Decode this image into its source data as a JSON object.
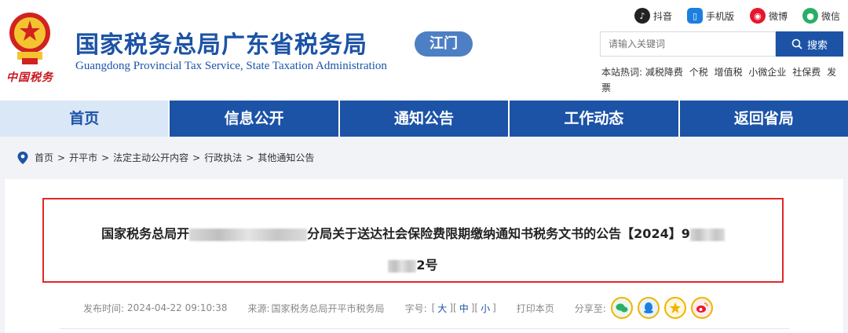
{
  "header": {
    "brand_script": "中国税务",
    "title": "国家税务总局广东省税务局",
    "subtitle": "Guangdong Provincial Tax Service, State Taxation Administration",
    "city_badge": "江门"
  },
  "social": [
    {
      "icon": "douyin-icon",
      "label": "抖音",
      "color": "#222222"
    },
    {
      "icon": "mobile-icon",
      "label": "手机版",
      "color": "#1c7fe0"
    },
    {
      "icon": "weibo-icon",
      "label": "微博",
      "color": "#e6162d"
    },
    {
      "icon": "wechat-icon",
      "label": "微信",
      "color": "#2aae67"
    }
  ],
  "search": {
    "placeholder": "请输入关键词",
    "button_label": "搜索"
  },
  "hotwords": {
    "label": "本站热词:",
    "items": [
      "减税降费",
      "个税",
      "增值税",
      "小微企业",
      "社保费",
      "发票"
    ]
  },
  "nav": {
    "items": [
      "首页",
      "信息公开",
      "通知公告",
      "工作动态",
      "返回省局"
    ],
    "active_index": 0
  },
  "breadcrumb": [
    "首页",
    "开平市",
    "法定主动公开内容",
    "行政执法",
    "其他通知公告"
  ],
  "article": {
    "title_part1": "国家税务总局开",
    "title_part2": "分局关于送达社会保险费限期缴纳通知书税务文书的公告【2024】9",
    "title_part3": "2号"
  },
  "meta": {
    "publish_label": "发布时间:",
    "publish_time": "2024-04-22 09:10:38",
    "source_label": "来源:",
    "source": "国家税务总局开平市税务局",
    "font_label": "字号:",
    "font_large": "大",
    "font_medium": "中",
    "font_small": "小",
    "print_label": "打印本页",
    "share_label": "分享至:"
  },
  "colors": {
    "brand_blue": "#1c53a6",
    "nav_active_bg": "#d9e7f7",
    "highlight_red": "#e02828"
  }
}
